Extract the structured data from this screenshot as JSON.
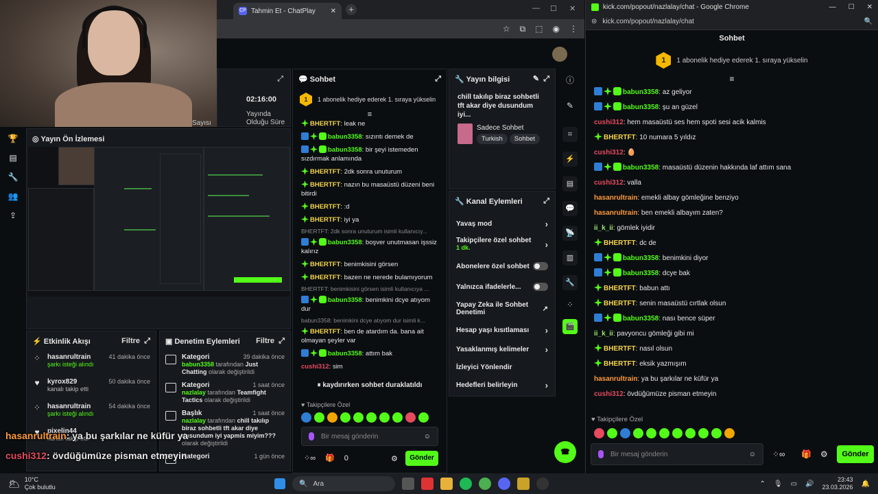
{
  "browser_tab": {
    "title": "Tahmin Et - ChatPlay",
    "fav": "CP",
    "new_tab": "+"
  },
  "stats": {
    "time": "02:16:00",
    "time_label": "Yayında Olduğu Süre",
    "left_label": "Sayısı"
  },
  "preview": {
    "title": "Yayın Ön İzlemesi"
  },
  "overlay": {
    "line1_user": "hasanrultrain",
    "line1_text": ": ya bu şarkılar ne küfür ya",
    "line2_user": "cushi312",
    "line2_text": ": övdüğümüze pisman etmeyin"
  },
  "feed": {
    "title": "Etkinlik Akışı",
    "filter": "Filtre",
    "items": [
      {
        "name": "hasanrultrain",
        "sub": "şarkı isteği alındı",
        "time": "41 dakika önce",
        "icon": "user-icon"
      },
      {
        "name": "kyrox829",
        "sub": "kanalı takip etti",
        "time": "50 dakika önce",
        "icon": "heart-icon"
      },
      {
        "name": "hasanrultrain",
        "sub": "şarkı isteği alındı",
        "time": "54 dakika önce",
        "icon": "user-icon"
      },
      {
        "name": "pixelin44",
        "sub": "kanalı takip etti",
        "time": "",
        "icon": "heart-icon"
      }
    ]
  },
  "moderation": {
    "title": "Denetim Eylemleri",
    "filter": "Filtre",
    "items": [
      {
        "title": "Kategori",
        "time": "39 dakika önce",
        "actor": "babun3358",
        "mid": " tarafından ",
        "value": "Just Chatting",
        "tail": " olarak değiştirildi"
      },
      {
        "title": "Kategori",
        "time": "1 saat önce",
        "actor": "nazlalay",
        "mid": " tarafından ",
        "value": "Teamfight Tactics",
        "tail": " olarak değiştirildi"
      },
      {
        "title": "Başlık",
        "time": "1 saat önce",
        "actor": "nazlalay",
        "mid": " tarafından ",
        "value": "chill takılıp biraz sohbetli tft akar diye dusundum iyi yapmis miyim???",
        "tail": " olarak değiştirildi"
      },
      {
        "title": "Kategori",
        "time": "1 gün önce",
        "actor": "",
        "mid": "",
        "value": "",
        "tail": ""
      }
    ]
  },
  "midchat": {
    "title": "Sohbet",
    "pin": "1 abonelik hediye ederek 1. sıraya yükselin",
    "coin": "1",
    "messages": [
      {
        "user": "BHERTFT",
        "color": "yellow",
        "badges": [
          "green"
        ],
        "text": ": leak ne",
        "reply": ""
      },
      {
        "user": "babun3358",
        "color": "green",
        "badges": [
          "blue",
          "green",
          "sub"
        ],
        "text": ": sızıntı demek de",
        "reply": ""
      },
      {
        "user": "babun3358",
        "color": "green",
        "badges": [
          "blue",
          "green",
          "sub"
        ],
        "text": ": bir şeyi istemeden sızdırmak anlamında",
        "reply": ""
      },
      {
        "user": "BHERTFT",
        "color": "yellow",
        "badges": [
          "green"
        ],
        "text": ": 2dk sonra unuturum",
        "reply": ""
      },
      {
        "user": "BHERTFT",
        "color": "yellow",
        "badges": [
          "green"
        ],
        "text": ": nazın bu masaüstü düzeni beni bitirdi",
        "reply": ""
      },
      {
        "user": "BHERTFT",
        "color": "yellow",
        "badges": [
          "green"
        ],
        "text": ": :d",
        "reply": ""
      },
      {
        "user": "BHERTFT",
        "color": "yellow",
        "badges": [
          "green"
        ],
        "text": ": iyi ya",
        "reply": ""
      },
      {
        "user": "babun3358",
        "color": "green",
        "badges": [
          "blue",
          "green",
          "sub"
        ],
        "text": ": boşver unutmasan işssiz kalırız",
        "reply": "BHERTFT: 2dk sonra unuturum isimli kullanıcıy..."
      },
      {
        "user": "BHERTFT",
        "color": "yellow",
        "badges": [
          "green"
        ],
        "text": ": benimkisini görsen",
        "reply": ""
      },
      {
        "user": "BHERTFT",
        "color": "yellow",
        "badges": [
          "green"
        ],
        "text": ": bazen ne nerede bulamıyorum",
        "reply": ""
      },
      {
        "user": "babun3358",
        "color": "green",
        "badges": [
          "blue",
          "green",
          "sub"
        ],
        "text": ": benimkini dcye atıyom dur",
        "reply": "BHERTFT: benimkisini görsen isimli kullanıcıya ..."
      },
      {
        "user": "BHERTFT",
        "color": "yellow",
        "badges": [
          "green"
        ],
        "text": ": ben de atardım da. bana ait olmayan şeyler var",
        "reply": "babun3358: benimkini dcye atıyom dur isimli k..."
      },
      {
        "user": "babun3358",
        "color": "green",
        "badges": [
          "blue",
          "green",
          "sub"
        ],
        "text": ": attım bak",
        "reply": ""
      },
      {
        "user": "cushi312",
        "color": "pink",
        "badges": [],
        "text": ": sim",
        "reply": ""
      }
    ],
    "paused": "kaydırırken sohbet duraklatıldı",
    "followers_only": "Takipçilere Özel",
    "input_placeholder": "Bir mesaj gönderin",
    "count": "0",
    "send": "Gönder"
  },
  "info": {
    "title": "Yayın bilgisi",
    "stream_title": "chill takılıp biraz sohbetli tft akar diye dusundum iyi...",
    "category": "Sadece Sohbet",
    "tags": [
      "Turkish",
      "Sohbet"
    ]
  },
  "actions": {
    "title": "Kanal Eylemleri",
    "items": [
      {
        "label": "Yavaş mod",
        "sub": "",
        "kind": "chevron"
      },
      {
        "label": "Takipçilere özel sohbet",
        "sub": "1 dk.",
        "kind": "chevron"
      },
      {
        "label": "Abonelere özel sohbet",
        "sub": "",
        "kind": "toggle"
      },
      {
        "label": "Yalnızca ifadelerle...",
        "sub": "",
        "kind": "toggle"
      },
      {
        "label": "Yapay Zeka ile Sohbet Denetimi",
        "sub": "",
        "kind": "external"
      },
      {
        "label": "Hesap yaşı kısıtlaması",
        "sub": "",
        "kind": "chevron"
      },
      {
        "label": "Yasaklanmış kelimeler",
        "sub": "",
        "kind": "chevron"
      },
      {
        "label": "İzleyici Yönlendir",
        "sub": "",
        "kind": "none"
      },
      {
        "label": "Hedefleri belirleyin",
        "sub": "",
        "kind": "chevron"
      }
    ]
  },
  "rightwin": {
    "title": "kick.com/popout/nazlalay/chat - Google Chrome",
    "url": "kick.com/popout/nazlalay/chat",
    "heading": "Sohbet",
    "pin": "1 abonelik hediye ederek 1. sıraya yükselin",
    "coin": "1",
    "messages": [
      {
        "user": "babun3358",
        "color": "green",
        "badges": [
          "blue",
          "green",
          "sub"
        ],
        "text": ": az geliyor"
      },
      {
        "user": "babun3358",
        "color": "green",
        "badges": [
          "blue",
          "green",
          "sub"
        ],
        "text": ": şu an güzel"
      },
      {
        "user": "cushi312",
        "color": "pink",
        "badges": [],
        "text": ": hem masaüstü ses hem spoti sesi acik kalmis"
      },
      {
        "user": "BHERTFT",
        "color": "yellow",
        "badges": [
          "green"
        ],
        "text": ": 10 numara 5 yıldız"
      },
      {
        "user": "cushi312",
        "color": "pink",
        "badges": [],
        "text": ": 🥚"
      },
      {
        "user": "babun3358",
        "color": "green",
        "badges": [
          "blue",
          "green",
          "sub"
        ],
        "text": ": masaüstü düzenin hakkında laf attım sana"
      },
      {
        "user": "cushi312",
        "color": "pink",
        "badges": [],
        "text": ": valla"
      },
      {
        "user": "hasanrultrain",
        "color": "orange",
        "badges": [],
        "text": ": emekli albay gömleğine benziyo"
      },
      {
        "user": "hasanrultrain",
        "color": "orange",
        "badges": [],
        "text": ": ben emekli albayım zaten?"
      },
      {
        "user": "ii_k_ii",
        "color": "lgreen",
        "badges": [],
        "text": ": gömlek iyidir"
      },
      {
        "user": "BHERTFT",
        "color": "yellow",
        "badges": [
          "green"
        ],
        "text": ": dc de"
      },
      {
        "user": "babun3358",
        "color": "green",
        "badges": [
          "blue",
          "green",
          "sub"
        ],
        "text": ": benimkini diyor"
      },
      {
        "user": "babun3358",
        "color": "green",
        "badges": [
          "blue",
          "green",
          "sub"
        ],
        "text": ": dcye bak"
      },
      {
        "user": "BHERTFT",
        "color": "yellow",
        "badges": [
          "green"
        ],
        "text": ": babun attı"
      },
      {
        "user": "BHERTFT",
        "color": "yellow",
        "badges": [
          "green"
        ],
        "text": ": senin masaüstü cırtlak olsun"
      },
      {
        "user": "babun3358",
        "color": "green",
        "badges": [
          "blue",
          "green",
          "sub"
        ],
        "text": ": nası bence süper"
      },
      {
        "user": "ii_k_ii",
        "color": "lgreen",
        "badges": [],
        "text": ": pavyoncu gömleği gibi mi"
      },
      {
        "user": "BHERTFT",
        "color": "yellow",
        "badges": [
          "green"
        ],
        "text": ": nasıl olsun"
      },
      {
        "user": "BHERTFT",
        "color": "yellow",
        "badges": [
          "green"
        ],
        "text": ": eksik yazmışım"
      },
      {
        "user": "hasanrultrain",
        "color": "orange",
        "badges": [],
        "text": ": ya bu şarkılar ne küfür ya"
      },
      {
        "user": "cushi312",
        "color": "pink",
        "badges": [],
        "text": ": övdüğümüze pisman etmeyin"
      }
    ],
    "followers_only": "Takipçilere Özel",
    "input_placeholder": "Bir mesaj gönderin",
    "send": "Gönder"
  },
  "taskbar": {
    "temp": "10°C",
    "weather": "Çok bulutlu",
    "search": "Ara",
    "time": "23:43",
    "date": "23.03.2026"
  },
  "colors": {
    "accent": "#53fc18",
    "bg": "#0b0e11",
    "panel": "#16191d"
  }
}
